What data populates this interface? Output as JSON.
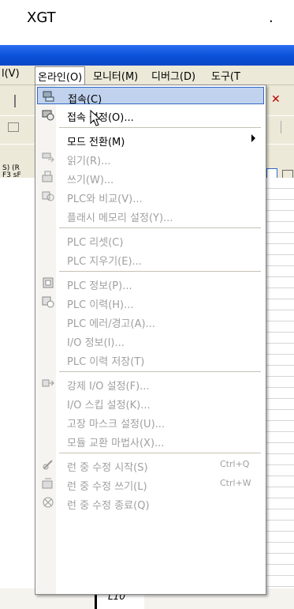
{
  "caption": {
    "title": "XGT",
    "trailing": "."
  },
  "menubar": {
    "items": [
      "l(V)",
      "온라인(O)",
      "모니터(M)",
      "디버그(D)",
      "도구(T"
    ]
  },
  "left_labels": {
    "top": "S) (R",
    "bottom": "F3 sF"
  },
  "menu": {
    "items": [
      {
        "label": "접속(C)",
        "enabled": true,
        "highlight": true,
        "icon": "connect-icon"
      },
      {
        "label": "접속 설정(O)...",
        "enabled": true,
        "icon": "connection-settings-icon"
      },
      {
        "label": "모드 전환(M)",
        "enabled": true,
        "submenu": true
      },
      {
        "label": "읽기(R)...",
        "enabled": false,
        "icon": "read-icon"
      },
      {
        "label": "쓰기(W)...",
        "enabled": false,
        "icon": "write-icon"
      },
      {
        "label": "PLC와 비교(V)...",
        "enabled": false,
        "icon": "compare-icon"
      },
      {
        "label": "플래시 메모리 설정(Y)...",
        "enabled": false
      },
      {
        "label": "PLC 리셋(C)",
        "enabled": false
      },
      {
        "label": "PLC 지우기(E)...",
        "enabled": false
      },
      {
        "label": "PLC 정보(P)...",
        "enabled": false,
        "icon": "plc-info-icon"
      },
      {
        "label": "PLC 이력(H)...",
        "enabled": false,
        "icon": "plc-history-icon"
      },
      {
        "label": "PLC 에러/경고(A)...",
        "enabled": false
      },
      {
        "label": "I/O 정보(I)...",
        "enabled": false
      },
      {
        "label": "PLC 이력 저장(T)",
        "enabled": false
      },
      {
        "label": "강제 I/O 설정(F)...",
        "enabled": false,
        "icon": "force-io-icon"
      },
      {
        "label": "I/O 스킵 설정(K)...",
        "enabled": false
      },
      {
        "label": "고장 마스크 설정(U)...",
        "enabled": false
      },
      {
        "label": "모듈 교환 마법사(X)...",
        "enabled": false
      },
      {
        "label": "런 중 수정 시작(S)",
        "shortcut": "Ctrl+Q",
        "enabled": false,
        "icon": "run-edit-start-icon"
      },
      {
        "label": "런 중 수정 쓰기(L)",
        "shortcut": "Ctrl+W",
        "enabled": false,
        "icon": "run-edit-write-icon"
      },
      {
        "label": "런 중 수정 종료(Q)",
        "enabled": false,
        "icon": "run-edit-end-icon"
      }
    ]
  },
  "ladder": {
    "label": "L10"
  },
  "colors": {
    "highlight": "#c1d2ee",
    "highlight_border": "#316ac5",
    "titlebar": "#0a50d8",
    "disabled": "#a0a0a0"
  }
}
